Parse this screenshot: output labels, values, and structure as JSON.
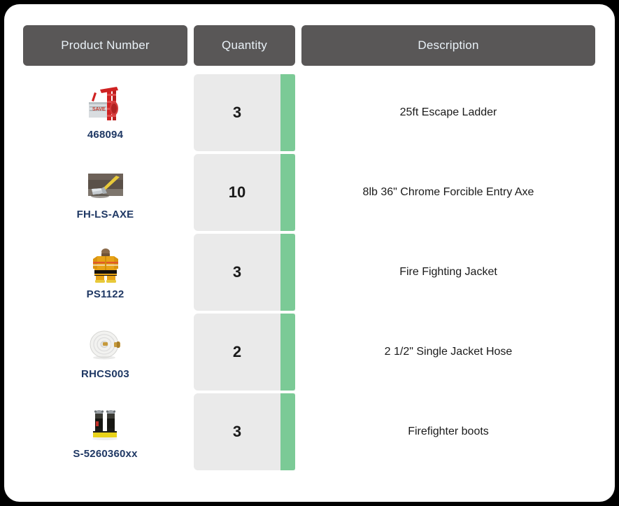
{
  "colors": {
    "page_background": "#000000",
    "panel_background": "#ffffff",
    "header_cell_background": "#595757",
    "header_text": "#eaf2f8",
    "quantity_cell_background": "#eaeaea",
    "quantity_bar_green": "#7bca96",
    "product_code_text": "#1f3864",
    "body_text": "#1a1a1a"
  },
  "table": {
    "columns": [
      {
        "key": "product_number",
        "label": "Product Number"
      },
      {
        "key": "quantity",
        "label": "Quantity"
      },
      {
        "key": "description",
        "label": "Description"
      }
    ],
    "rows": [
      {
        "product_number": "468094",
        "quantity": "3",
        "description": "25ft Escape Ladder",
        "thumbnail": "escape-ladder-image"
      },
      {
        "product_number": "FH-LS-AXE",
        "quantity": "10",
        "description": "8lb 36\" Chrome Forcible Entry Axe",
        "thumbnail": "forcible-entry-axe-image"
      },
      {
        "product_number": "PS1122",
        "quantity": "3",
        "description": "Fire Fighting Jacket",
        "thumbnail": "fire-fighting-jacket-image"
      },
      {
        "product_number": "RHCS003",
        "quantity": "2",
        "description": "2 1/2\" Single Jacket Hose",
        "thumbnail": "single-jacket-hose-image"
      },
      {
        "product_number": "S-5260360xx",
        "quantity": "3",
        "description": "Firefighter boots",
        "thumbnail": "firefighter-boots-image"
      }
    ]
  }
}
